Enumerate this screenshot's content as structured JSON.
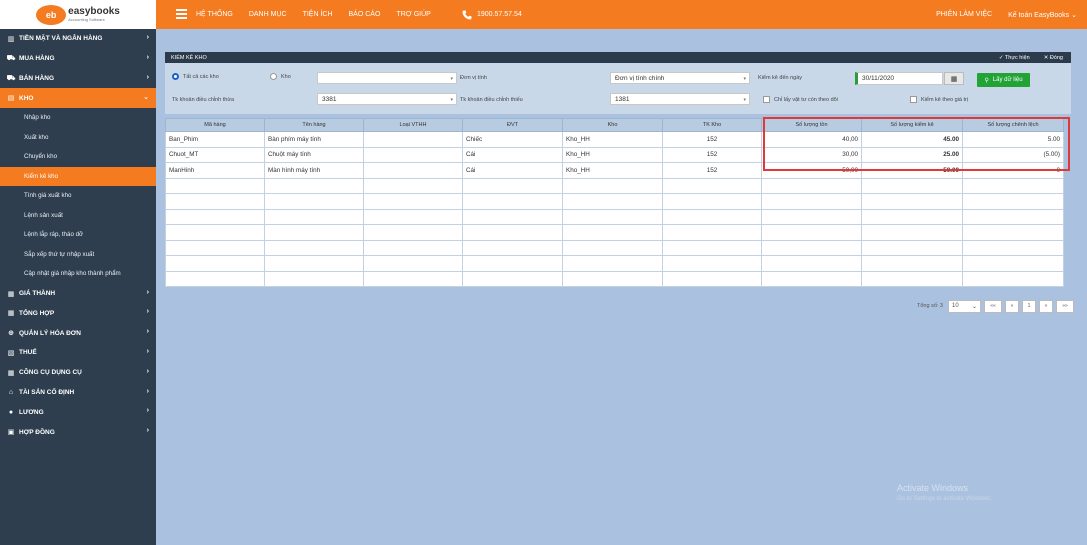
{
  "header": {
    "logo_icon": "eb",
    "logo_name": "easybooks",
    "logo_sub": "Accounting Software",
    "menu": [
      "HỆ THỐNG",
      "DANH MỤC",
      "TIỆN ÍCH",
      "BÁO CÁO",
      "TRỢ GIÚP"
    ],
    "phone": "1900.57.57.54",
    "work_session": "PHIÊN LÀM VIỆC",
    "user": "Kế toán EasyBooks ⌄",
    "accent_color": "#f47b20"
  },
  "sidebar": {
    "items": [
      {
        "icon": "cash-icon",
        "label": "TIỀN MẶT VÀ NGÂN HÀNG"
      },
      {
        "icon": "cart-icon",
        "label": "MUA HÀNG"
      },
      {
        "icon": "cart-icon",
        "label": "BÁN HÀNG"
      },
      {
        "icon": "warehouse-icon",
        "label": "KHO"
      }
    ],
    "kho_subitems": [
      "Nhập kho",
      "Xuất kho",
      "Chuyển kho",
      "Kiểm kê kho",
      "Tính giá xuất kho",
      "Lệnh sản xuất",
      "Lệnh lắp ráp, tháo dỡ",
      "Sắp xếp thứ tự nhập xuất",
      "Cập nhật giá nhập kho thành phẩm"
    ],
    "active_sub": "Kiểm kê kho",
    "items_after": [
      {
        "icon": "document-icon",
        "label": "GIÁ THÀNH"
      },
      {
        "icon": "document-icon",
        "label": "TỔNG HỢP"
      },
      {
        "icon": "invoice-icon",
        "label": "QUẢN LÝ HÓA ĐƠN"
      },
      {
        "icon": "tax-icon",
        "label": "THUẾ"
      },
      {
        "icon": "document-icon",
        "label": "CÔNG CỤ DỤNG CỤ"
      },
      {
        "icon": "building-icon",
        "label": "TÀI SẢN CỐ ĐỊNH"
      },
      {
        "icon": "user-icon",
        "label": "LƯƠNG"
      },
      {
        "icon": "contract-icon",
        "label": "HỢP ĐỒNG"
      }
    ]
  },
  "panel": {
    "title": "KIỂM KÊ KHO",
    "execute": "✓ Thực hiện",
    "close": "✕ Đóng"
  },
  "filters": {
    "all_warehouses": "Tất cả các kho",
    "warehouse": "Kho",
    "warehouse_value": "",
    "unit_label": "Đơn vị tính",
    "unit_value": "Đơn vị tính chính",
    "check_to_date": "Kiểm kê đến ngày",
    "date_value": "30/11/2020",
    "get_data": "Lấy dữ liệu",
    "surplus_account_label": "Tk khoản điều chỉnh thừa",
    "surplus_account_value": "3381",
    "deficit_account_label": "Tk khoản điều chỉnh thiếu",
    "deficit_account_value": "1381",
    "only_tracked": "Chỉ lấy vật tư còn theo dõi",
    "check_by_value": "Kiểm kê theo giá trị"
  },
  "table": {
    "columns": [
      "Mã hàng",
      "Tên hàng",
      "Loại VTHH",
      "ĐVT",
      "Kho",
      "TK Kho",
      "Số lượng tồn",
      "Số lượng kiểm kê",
      "Số lượng chênh lệch"
    ],
    "rows": [
      [
        "Ban_Phim",
        "Bàn phím máy tính",
        "",
        "Chiếc",
        "Kho_HH",
        "152",
        "40,00",
        "45.00",
        "5.00"
      ],
      [
        "Chuot_MT",
        "Chuột máy tính",
        "",
        "Cái",
        "Kho_HH",
        "152",
        "30,00",
        "25.00",
        "(5.00)"
      ],
      [
        "ManHinh",
        "Màn hình máy tính",
        "",
        "Cái",
        "Kho_HH",
        "152",
        "50,00",
        "50.00",
        "0"
      ]
    ],
    "highlight_color": "#e0393a"
  },
  "pager": {
    "total": "Tổng số: 3",
    "page_size": "10",
    "first": "««",
    "prev": "«",
    "page": "1",
    "next": "»",
    "last": "»»"
  },
  "watermark": {
    "line1": "Activate Windows",
    "line2": "Go to Settings to activate Windows."
  }
}
